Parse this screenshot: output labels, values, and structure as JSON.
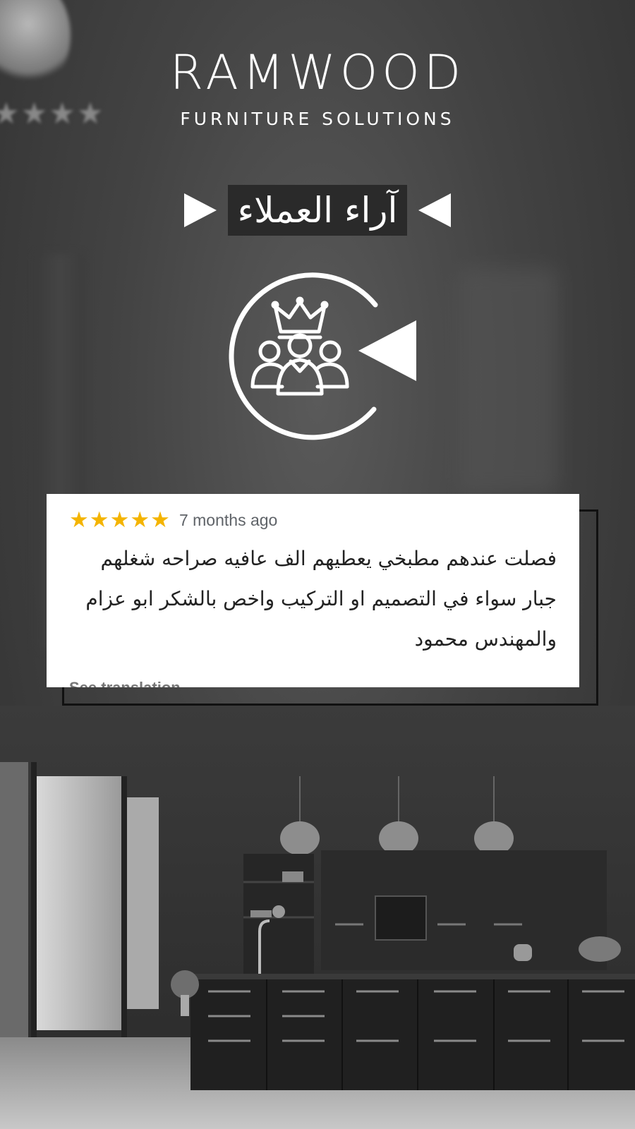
{
  "brand": {
    "name": "RAMWOOD",
    "tagline": "FURNITURE SOLUTIONS"
  },
  "section": {
    "title": "آراء العملاء"
  },
  "review": {
    "rating": 5,
    "stars": "★★★★★",
    "age": "7 months ago",
    "text": "فصلت عندهم مطبخي يعطيهم الف عافيه صراحه شغلهم جبار سواء في التصميم او التركيب واخص بالشكر ابو عزام والمهندس محمود",
    "see_translation": "See translation"
  },
  "colors": {
    "star": "#f4b400",
    "background": "#434343",
    "title_box": "#2a2a2a",
    "card": "#ffffff"
  },
  "icons": [
    "crown-icon",
    "customers-group-icon",
    "play-triangle-icon"
  ]
}
